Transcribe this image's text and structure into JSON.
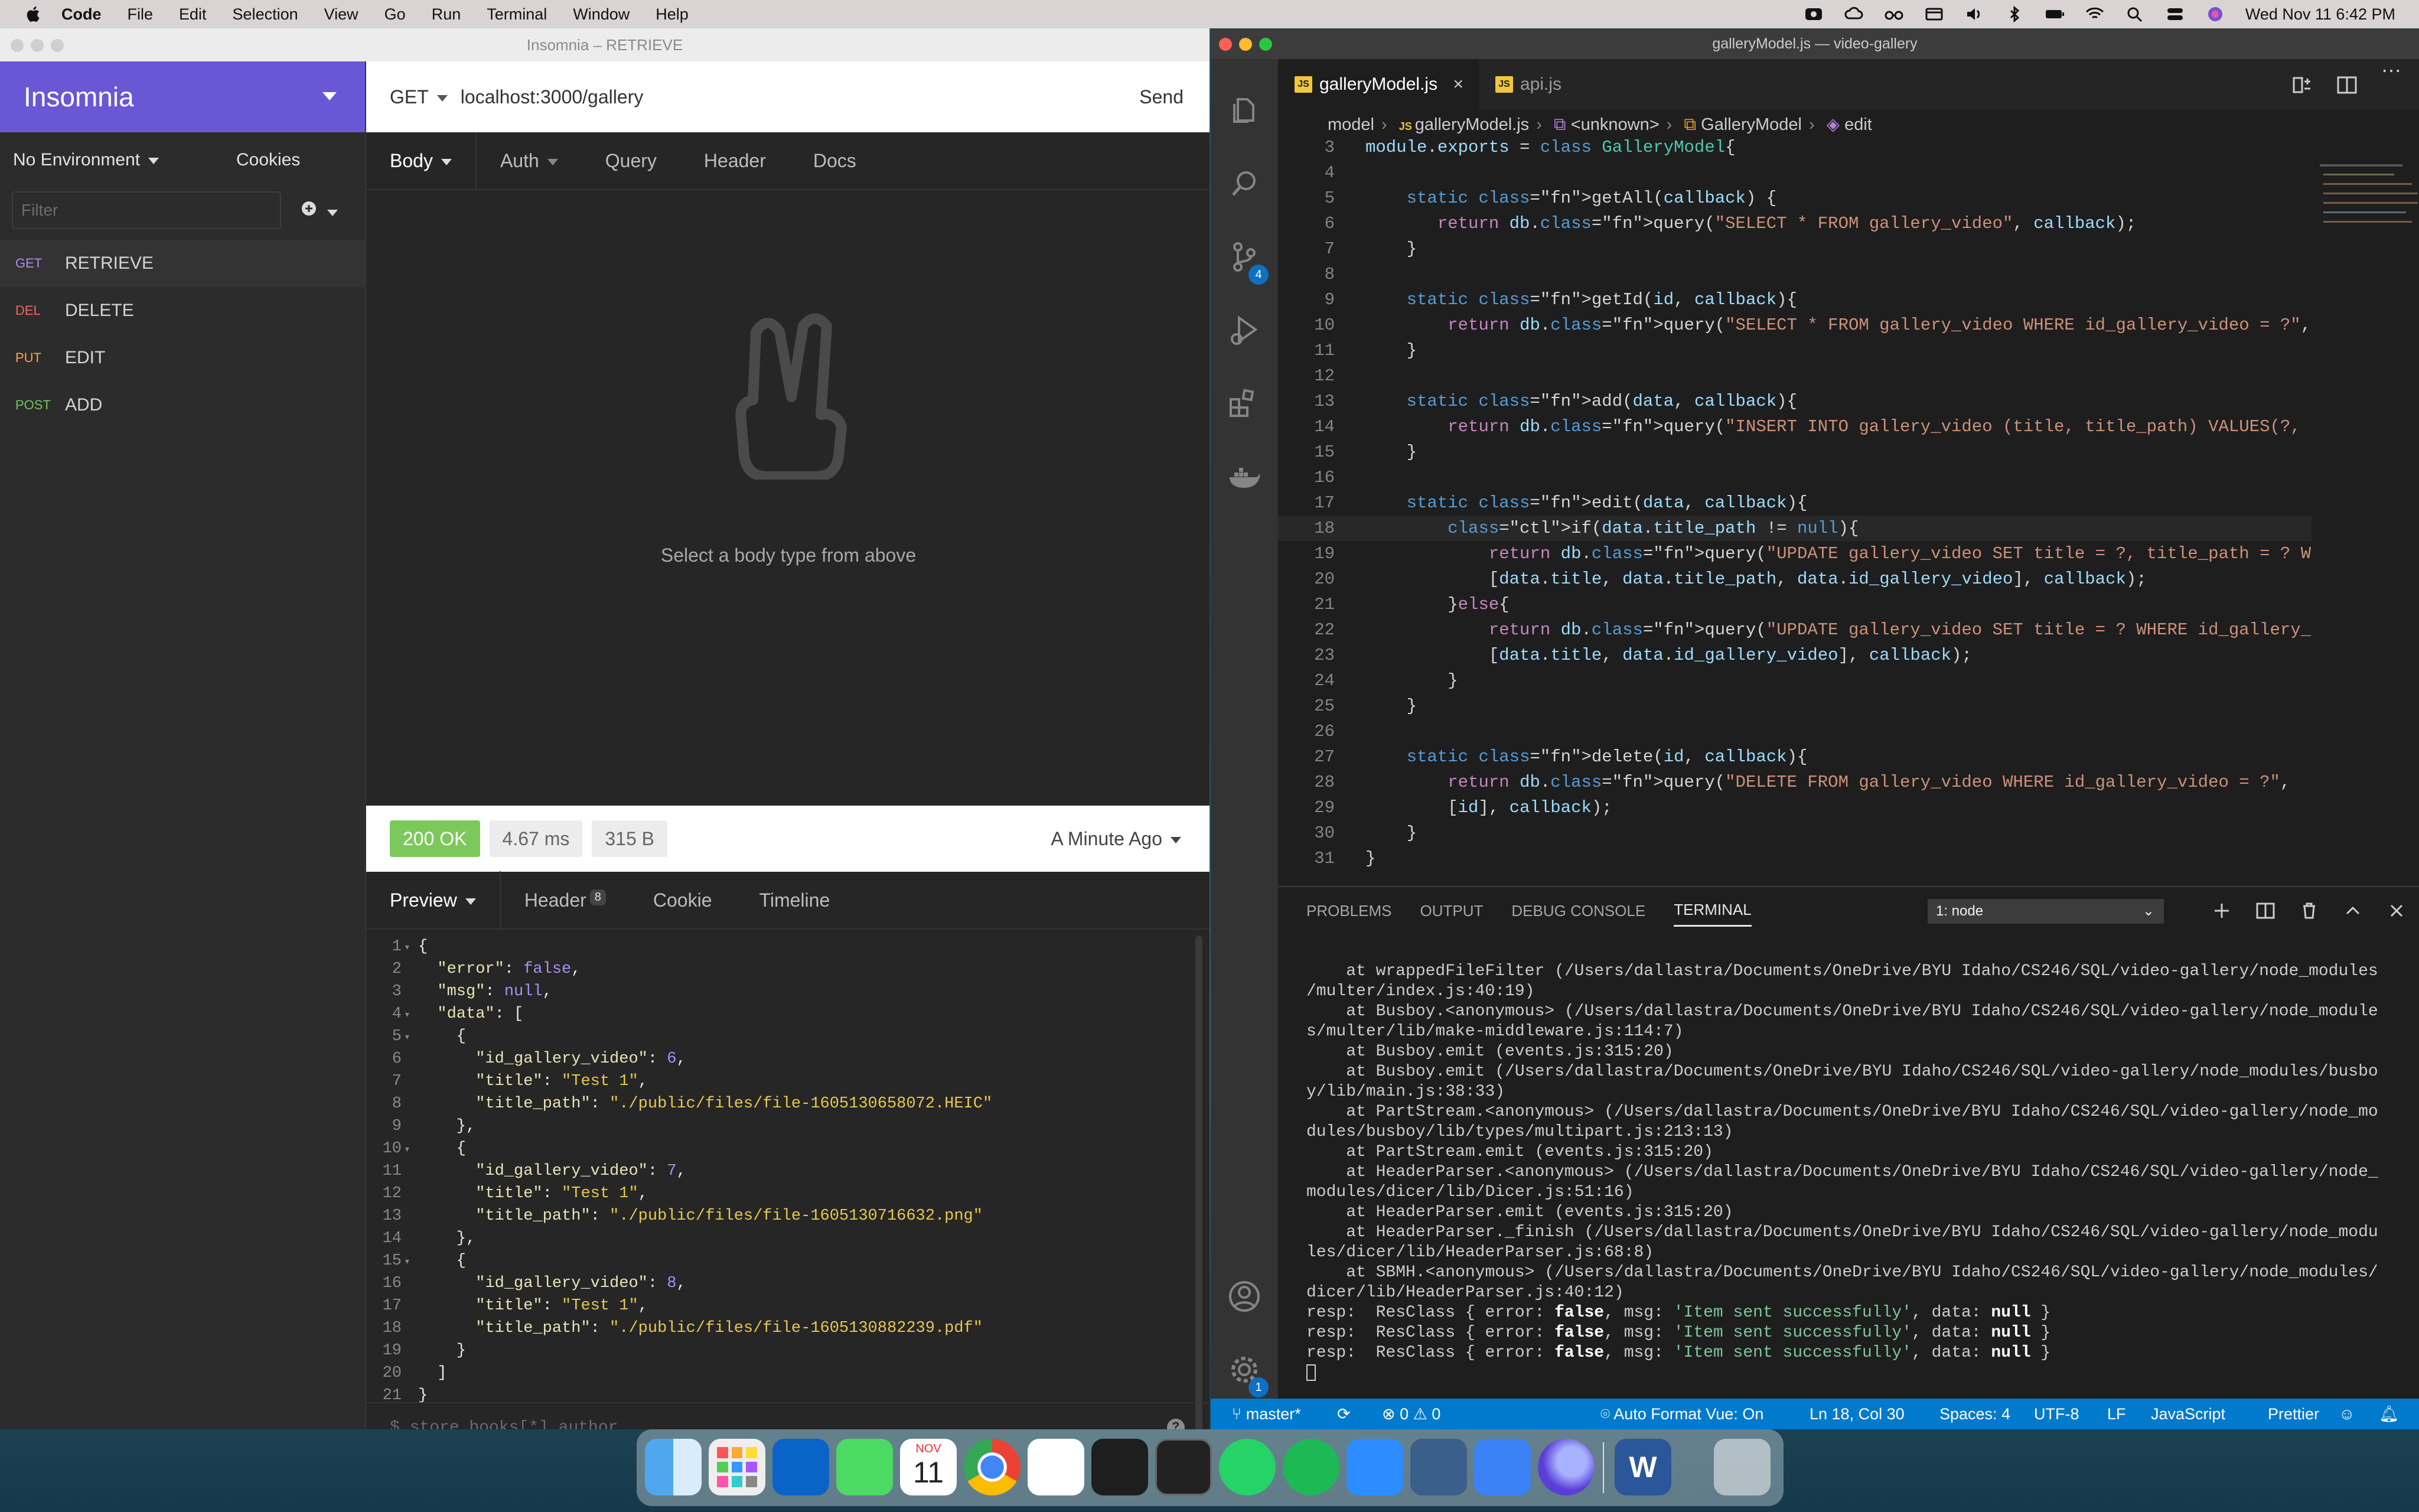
{
  "menubar": {
    "app": "Code",
    "items": [
      "File",
      "Edit",
      "Selection",
      "View",
      "Go",
      "Run",
      "Terminal",
      "Window",
      "Help"
    ],
    "clock": "Wed Nov 11  6:42 PM"
  },
  "insomnia": {
    "window_title": "Insomnia – RETRIEVE",
    "brand": "Insomnia",
    "environment": "No Environment",
    "cookies": "Cookies",
    "filter_placeholder": "Filter",
    "requests": [
      {
        "method": "GET",
        "name": "RETRIEVE",
        "color": "#a98cf0"
      },
      {
        "method": "DEL",
        "name": "DELETE",
        "color": "#e86a5c"
      },
      {
        "method": "PUT",
        "name": "EDIT",
        "color": "#f2a650"
      },
      {
        "method": "POST",
        "name": "ADD",
        "color": "#71c35a"
      }
    ],
    "url": {
      "method": "GET",
      "value": "localhost:3000/gallery",
      "send": "Send"
    },
    "request_tabs": [
      "Body",
      "Auth",
      "Query",
      "Header",
      "Docs"
    ],
    "empty_message": "Select a body type from above",
    "response": {
      "status": "200 OK",
      "time": "4.67 ms",
      "size": "315 B",
      "when": "A Minute Ago"
    },
    "response_tabs": {
      "preview": "Preview",
      "header": "Header",
      "header_count": "8",
      "cookie": "Cookie",
      "timeline": "Timeline"
    },
    "json_lines": [
      "{",
      "  \"error\": false,",
      "  \"msg\": null,",
      "  \"data\": [",
      "    {",
      "      \"id_gallery_video\": 6,",
      "      \"title\": \"Test 1\",",
      "      \"title_path\": \"./public/files/file-1605130658072.HEIC\"",
      "    },",
      "    {",
      "      \"id_gallery_video\": 7,",
      "      \"title\": \"Test 1\",",
      "      \"title_path\": \"./public/files/file-1605130716632.png\"",
      "    },",
      "    {",
      "      \"id_gallery_video\": 8,",
      "      \"title\": \"Test 1\",",
      "      \"title_path\": \"./public/files/file-1605130882239.pdf\"",
      "    }",
      "  ]",
      "}"
    ],
    "json_filter_placeholder": "$.store.books[*].author"
  },
  "vscode": {
    "window_title": "galleryModel.js — video-gallery",
    "tabs": [
      "galleryModel.js",
      "api.js"
    ],
    "breadcrumb": [
      "model",
      "galleryModel.js",
      "<unknown>",
      "GalleryModel",
      "edit"
    ],
    "scm_badge": "4",
    "settings_badge": "1",
    "code_lines": [
      {
        "n": "3",
        "t": "module.exports = class GalleryModel{"
      },
      {
        "n": "4",
        "t": ""
      },
      {
        "n": "5",
        "t": "    static getAll(callback) {"
      },
      {
        "n": "6",
        "t": "       return db.query(\"SELECT * FROM gallery_video\", callback);"
      },
      {
        "n": "7",
        "t": "    }"
      },
      {
        "n": "8",
        "t": ""
      },
      {
        "n": "9",
        "t": "    static getId(id, callback){"
      },
      {
        "n": "10",
        "t": "        return db.query(\"SELECT * FROM gallery_video WHERE id_gallery_video = ?\", [id], c"
      },
      {
        "n": "11",
        "t": "    }"
      },
      {
        "n": "12",
        "t": ""
      },
      {
        "n": "13",
        "t": "    static add(data, callback){"
      },
      {
        "n": "14",
        "t": "        return db.query(\"INSERT INTO gallery_video (title, title_path) VALUES(?, ?)\", [da"
      },
      {
        "n": "15",
        "t": "    }"
      },
      {
        "n": "16",
        "t": ""
      },
      {
        "n": "17",
        "t": "    static edit(data, callback){"
      },
      {
        "n": "18",
        "t": "        if(data.title_path != null){"
      },
      {
        "n": "19",
        "t": "            return db.query(\"UPDATE gallery_video SET title = ?, title_path = ? WHERE id_"
      },
      {
        "n": "20",
        "t": "            [data.title, data.title_path, data.id_gallery_video], callback);"
      },
      {
        "n": "21",
        "t": "        }else{"
      },
      {
        "n": "22",
        "t": "            return db.query(\"UPDATE gallery_video SET title = ? WHERE id_gallery_video = "
      },
      {
        "n": "23",
        "t": "            [data.title, data.id_gallery_video], callback);"
      },
      {
        "n": "24",
        "t": "        }"
      },
      {
        "n": "25",
        "t": "    }"
      },
      {
        "n": "26",
        "t": ""
      },
      {
        "n": "27",
        "t": "    static delete(id, callback){"
      },
      {
        "n": "28",
        "t": "        return db.query(\"DELETE FROM gallery_video WHERE id_gallery_video = ?\","
      },
      {
        "n": "29",
        "t": "        [id], callback);"
      },
      {
        "n": "30",
        "t": "    }"
      },
      {
        "n": "31",
        "t": "}"
      }
    ],
    "panel_tabs": [
      "PROBLEMS",
      "OUTPUT",
      "DEBUG CONSOLE",
      "TERMINAL"
    ],
    "terminal_select": "1: node",
    "terminal_lines": [
      "    at wrappedFileFilter (/Users/dallastra/Documents/OneDrive/BYU Idaho/CS246/SQL/video-gallery/node_modules",
      "/multer/index.js:40:19)",
      "    at Busboy.<anonymous> (/Users/dallastra/Documents/OneDrive/BYU Idaho/CS246/SQL/video-gallery/node_module",
      "s/multer/lib/make-middleware.js:114:7)",
      "    at Busboy.emit (events.js:315:20)",
      "    at Busboy.emit (/Users/dallastra/Documents/OneDrive/BYU Idaho/CS246/SQL/video-gallery/node_modules/busbo",
      "y/lib/main.js:38:33)",
      "    at PartStream.<anonymous> (/Users/dallastra/Documents/OneDrive/BYU Idaho/CS246/SQL/video-gallery/node_mo",
      "dules/busboy/lib/types/multipart.js:213:13)",
      "    at PartStream.emit (events.js:315:20)",
      "    at HeaderParser.<anonymous> (/Users/dallastra/Documents/OneDrive/BYU Idaho/CS246/SQL/video-gallery/node_",
      "modules/dicer/lib/Dicer.js:51:16)",
      "    at HeaderParser.emit (events.js:315:20)",
      "    at HeaderParser._finish (/Users/dallastra/Documents/OneDrive/BYU Idaho/CS246/SQL/video-gallery/node_modu",
      "les/dicer/lib/HeaderParser.js:68:8)",
      "    at SBMH.<anonymous> (/Users/dallastra/Documents/OneDrive/BYU Idaho/CS246/SQL/video-gallery/node_modules/",
      "dicer/lib/HeaderParser.js:40:12)"
    ],
    "resp_lines": [
      {
        "pre": "resp:  ResClass { error: ",
        "b1": "false",
        "mid": ", msg: ",
        "msg": "'Item sent successfully'",
        "mid2": ", data: ",
        "b2": "null",
        "end": " }"
      },
      {
        "pre": "resp:  ResClass { error: ",
        "b1": "false",
        "mid": ", msg: ",
        "msg": "'Item sent successfully'",
        "mid2": ", data: ",
        "b2": "null",
        "end": " }"
      },
      {
        "pre": "resp:  ResClass { error: ",
        "b1": "false",
        "mid": ", msg: ",
        "msg": "'Item sent successfully'",
        "mid2": ", data: ",
        "b2": "null",
        "end": " }"
      }
    ],
    "status": {
      "branch": "master*",
      "errors": "0",
      "warnings": "0",
      "auto_format": "Auto Format Vue: On",
      "position": "Ln 18, Col 30",
      "spaces": "Spaces: 4",
      "encoding": "UTF-8",
      "eol": "LF",
      "language": "JavaScript",
      "formatter": "Prettier"
    }
  },
  "dock": {
    "calendar_month": "NOV",
    "calendar_day": "11",
    "word_letter": "W"
  }
}
